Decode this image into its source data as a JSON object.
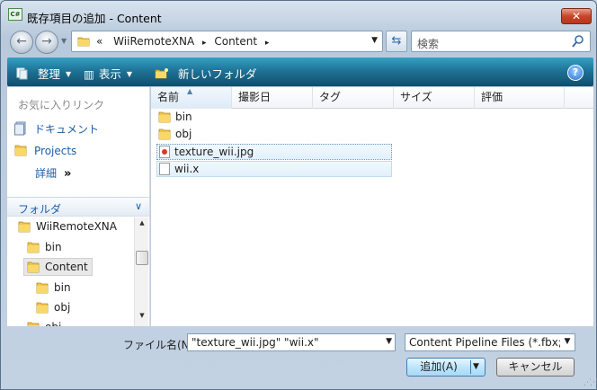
{
  "window": {
    "title": "既存項目の追加 - Content",
    "app_icon_text": "C#",
    "close_label": "✕"
  },
  "address_bar": {
    "prefix": "«",
    "segments": [
      "WiiRemoteXNA",
      "Content"
    ],
    "separator": "▸"
  },
  "search": {
    "placeholder": "検索"
  },
  "toolbar": {
    "organize_label": "整理",
    "views_label": "表示",
    "new_folder_label": "新しいフォルダ",
    "help_label": "?"
  },
  "navigation": {
    "favorites_header": "お気に入りリンク",
    "favorites": [
      {
        "label": "ドキュメント",
        "icon": "documents-icon"
      },
      {
        "label": "Projects",
        "icon": "folder-icon"
      }
    ],
    "more_label": "詳細",
    "more_arrow": "»",
    "folders_header": "フォルダ",
    "tree": [
      {
        "label": "WiiRemoteXNA",
        "level": 0
      },
      {
        "label": "bin",
        "level": 1
      },
      {
        "label": "Content",
        "level": 1,
        "selected": true
      },
      {
        "label": "bin",
        "level": 2
      },
      {
        "label": "obj",
        "level": 2
      },
      {
        "label": "obj",
        "level": 1
      }
    ]
  },
  "file_list": {
    "columns": [
      "名前",
      "撮影日",
      "タグ",
      "サイズ",
      "評価"
    ],
    "sorted_column": "名前",
    "items": [
      {
        "name": "bin",
        "type": "folder"
      },
      {
        "name": "obj",
        "type": "folder"
      },
      {
        "name": "texture_wii.jpg",
        "type": "jpg",
        "selected": true,
        "focused": true
      },
      {
        "name": "wii.x",
        "type": "file",
        "selected": true
      }
    ]
  },
  "footer": {
    "filename_label": "ファイル名(N):",
    "filename_value": "\"texture_wii.jpg\" \"wii.x\"",
    "filetype_value": "Content Pipeline Files (*.fbx;*.x;",
    "open_label": "追加(A)",
    "cancel_label": "キャンセル"
  },
  "colors": {
    "toolbar": "#1d6f92",
    "link": "#1a5ea8",
    "selection": "#e1f0fb"
  }
}
